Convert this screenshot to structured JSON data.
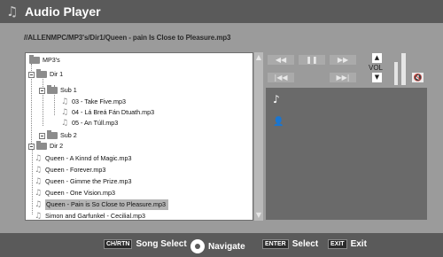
{
  "window": {
    "title": "Audio Player"
  },
  "path": "//ALLENMPC/MP3's/Dir1/Queen - pain Is Close to Pleasure.mp3",
  "tree": {
    "root": "MP3's",
    "dir1": "Dir 1",
    "sub1": "Sub 1",
    "sub1_files": [
      "03 - Take Five.mp3",
      "04 - Lá Breá Fán Dtuath.mp3",
      "05 - An Túll.mp3"
    ],
    "sub2": "Sub 2",
    "dir2": "Dir 2",
    "files": [
      "Queen - A Kinnd of Magic.mp3",
      "Queen - Forever.mp3",
      "Queen - Gimme the Prize.mp3",
      "Queen - One Vision.mp3",
      "Queen - Pain is So Close to Pleasure.mp3",
      "Simon and Garfunkel - Cecilial.mp3"
    ],
    "selected_index": 4
  },
  "controls": {
    "volume_label": "VOL",
    "icons": [
      "rewind-icon",
      "pause-icon",
      "fast-forward-icon",
      "previous-track-icon",
      "next-track-icon",
      "volume-up-icon",
      "volume-down-icon",
      "mute-icon"
    ]
  },
  "info": {
    "icons": [
      "music-note-icon",
      "artist-icon"
    ]
  },
  "bottom": {
    "song_select_key": "CH/RTN",
    "song_select_label": "Song Select",
    "navigate_label": "Navigate",
    "select_key": "ENTER",
    "select_label": "Select",
    "exit_key": "EXIT",
    "exit_label": "Exit"
  },
  "colors": {
    "background": "#9b9b9b",
    "bar": "#5a5a5a",
    "list_bg": "#ffffff",
    "selected": "#b4b4b4",
    "info_bg": "#6a6a6a"
  }
}
